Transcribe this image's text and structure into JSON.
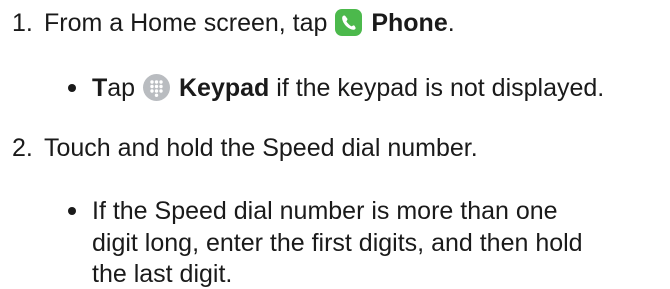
{
  "steps": [
    {
      "number": "1.",
      "text_before": "From a Home screen, tap",
      "icon": "phone-icon",
      "bold": "Phone",
      "text_after": ".",
      "substeps": [
        {
          "bold_first": "T",
          "text_a": "ap",
          "icon": "keypad-icon",
          "bold": "Keypad",
          "text_after": "if the keypad is not displayed."
        }
      ]
    },
    {
      "number": "2.",
      "text": "Touch and hold the Speed dial number.",
      "substeps": [
        {
          "lines": [
            "If the Speed dial number is more than one",
            "digit long, enter the first digits, and then hold",
            "the last digit."
          ]
        }
      ]
    }
  ],
  "colors": {
    "phone_icon": "#4cb94c",
    "keypad_icon": "#b9bcc0",
    "text": "#1a1a1a"
  }
}
